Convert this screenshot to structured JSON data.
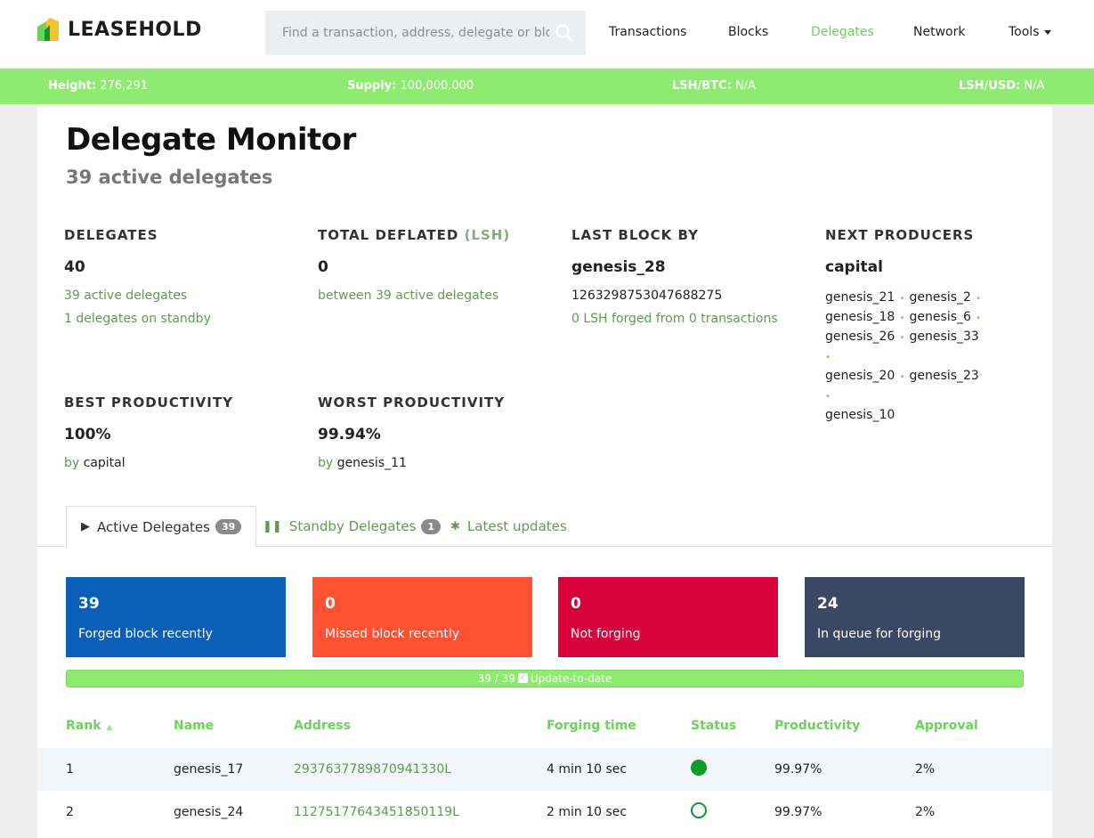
{
  "brand": {
    "name": "LEASEHOLD"
  },
  "search": {
    "placeholder": "Find a transaction, address, delegate or block"
  },
  "nav": {
    "items": [
      {
        "label": "Transactions"
      },
      {
        "label": "Blocks"
      },
      {
        "label": "Delegates",
        "active": true
      },
      {
        "label": "Network"
      },
      {
        "label": "Tools"
      }
    ]
  },
  "stats": {
    "height_label": "Height:",
    "height_value": "276,291",
    "supply_label": "Supply:",
    "supply_value": "100,000,000",
    "btc_label": "LSH/BTC:",
    "btc_value": "N/A",
    "usd_label": "LSH/USD:",
    "usd_value": "N/A"
  },
  "page": {
    "title": "Delegate Monitor",
    "subtitle": "39 active delegates"
  },
  "summary": {
    "delegates": {
      "label": "DELEGATES",
      "value": "40",
      "line1": "39 active delegates",
      "line2": "1 delegates on standby"
    },
    "deflated": {
      "label": "TOTAL DEFLATED",
      "unit": "(LSH)",
      "value": "0",
      "line1": "between 39 active delegates"
    },
    "last_block": {
      "label": "LAST BLOCK BY",
      "value": "genesis_28",
      "line1": "1263298753047688275",
      "line2": "0 LSH forged from 0 transactions"
    },
    "next_producers": {
      "label": "NEXT PRODUCERS",
      "value": "capital",
      "list": [
        "genesis_21",
        "genesis_2",
        "genesis_18",
        "genesis_6",
        "genesis_26",
        "genesis_33",
        "genesis_20",
        "genesis_23",
        "genesis_10"
      ]
    },
    "best": {
      "label": "BEST PRODUCTIVITY",
      "value": "100%",
      "by": "by",
      "name": "capital"
    },
    "worst": {
      "label": "WORST PRODUCTIVITY",
      "value": "99.94%",
      "by": "by",
      "name": "genesis_11"
    }
  },
  "tabs": [
    {
      "label": "Active Delegates",
      "count": "39",
      "icon": "play-icon"
    },
    {
      "label": "Standby Delegates",
      "count": "1",
      "icon": "pause-icon"
    },
    {
      "label": "Latest updates",
      "icon": "asterisk-icon"
    }
  ],
  "cards": [
    {
      "value": "39",
      "label": "Forged block recently",
      "color": "#0b5fb8"
    },
    {
      "value": "0",
      "label": "Missed block recently",
      "color": "#ff5233"
    },
    {
      "value": "0",
      "label": "Not forging",
      "color": "#d9013a"
    },
    {
      "value": "24",
      "label": "In queue for forging",
      "color": "#3b4863"
    }
  ],
  "progress": {
    "left": "39 / 39",
    "text": "Update-to-date",
    "fraction": 1.0
  },
  "table": {
    "columns": [
      "Rank",
      "Name",
      "Address",
      "Forging time",
      "Status",
      "Productivity",
      "Approval"
    ],
    "rows": [
      {
        "rank": "1",
        "name": "genesis_17",
        "address": "2937637789870941330L",
        "time": "4 min 10 sec",
        "status": "forged",
        "productivity": "99.97%",
        "approval": "2%"
      },
      {
        "rank": "2",
        "name": "genesis_24",
        "address": "11275177643451850119L",
        "time": "2 min 10 sec",
        "status": "awaiting",
        "productivity": "99.97%",
        "approval": "2%"
      }
    ]
  }
}
